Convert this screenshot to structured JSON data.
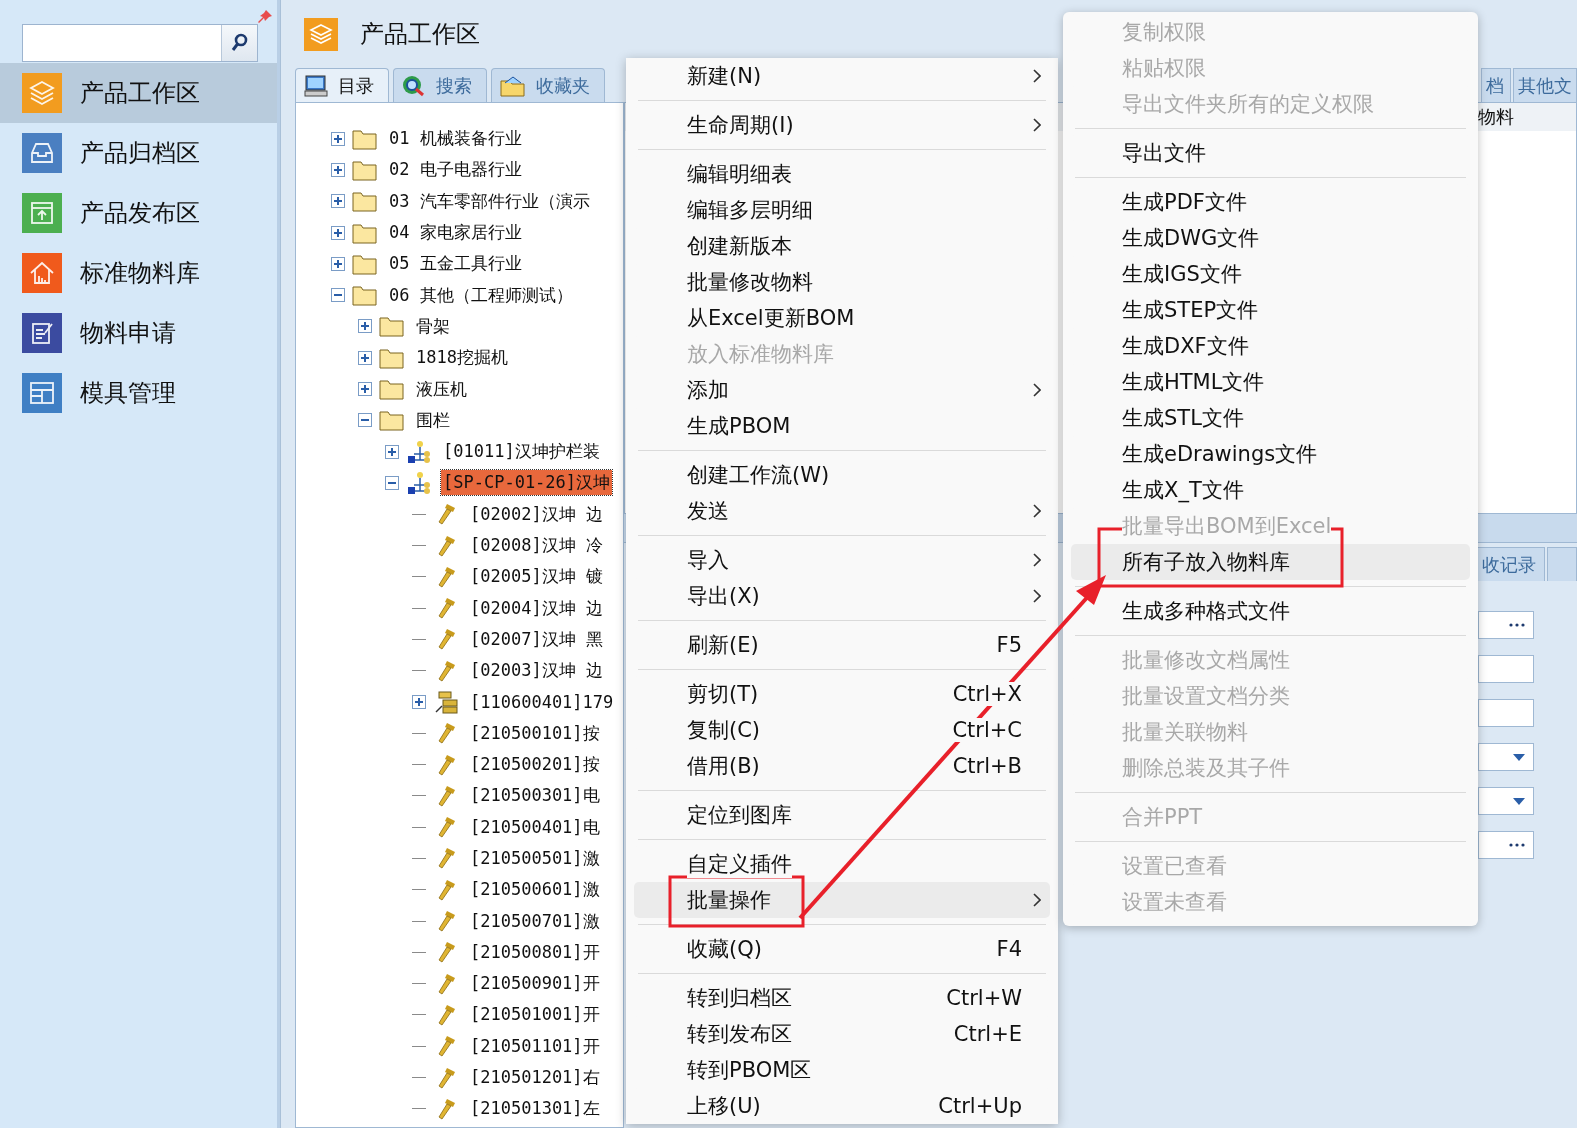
{
  "sidebar": {
    "items": [
      {
        "label": "产品工作区",
        "selected": true
      },
      {
        "label": "产品归档区",
        "selected": false
      },
      {
        "label": "产品发布区",
        "selected": false
      },
      {
        "label": "标准物料库",
        "selected": false
      },
      {
        "label": "物料申请",
        "selected": false
      },
      {
        "label": "模具管理",
        "selected": false
      }
    ]
  },
  "workspace": {
    "title": "产品工作区",
    "tabs": [
      {
        "label": "目录",
        "selected": true
      },
      {
        "label": "搜索",
        "selected": false
      },
      {
        "label": "收藏夹",
        "selected": false
      }
    ],
    "tree": [
      {
        "kind": "folder",
        "label": "01 机械装备行业",
        "expanded": false,
        "selected": false
      },
      {
        "kind": "folder",
        "label": "02 电子电器行业",
        "expanded": false,
        "selected": false
      },
      {
        "kind": "folder",
        "label": "03 汽车零部件行业（演示",
        "expanded": false,
        "selected": false
      },
      {
        "kind": "folder",
        "label": "04 家电家居行业",
        "expanded": false,
        "selected": false
      },
      {
        "kind": "folder",
        "label": "05 五金工具行业",
        "expanded": false,
        "selected": false
      },
      {
        "kind": "folder",
        "label": "06 其他（工程师测试）",
        "expanded": true,
        "selected": false,
        "children": [
          {
            "kind": "folder",
            "label": "骨架",
            "expanded": false,
            "selected": false
          },
          {
            "kind": "folder",
            "label": "1818挖掘机",
            "expanded": false,
            "selected": false
          },
          {
            "kind": "folder",
            "label": "液压机",
            "expanded": false,
            "selected": false
          },
          {
            "kind": "folder",
            "label": "围栏",
            "expanded": true,
            "selected": false,
            "children": [
              {
                "kind": "assembly",
                "label": "[01011]汉坤护栏装",
                "expanded": false,
                "selected": false
              },
              {
                "kind": "assembly",
                "label": "[SP-CP-01-26]汉坤",
                "expanded": true,
                "selected": true,
                "children": [
                  {
                    "kind": "part",
                    "label": "[02002]汉坤 边",
                    "selected": false
                  },
                  {
                    "kind": "part",
                    "label": "[02008]汉坤 冷",
                    "selected": false
                  },
                  {
                    "kind": "part",
                    "label": "[02005]汉坤 镀",
                    "selected": false
                  },
                  {
                    "kind": "part",
                    "label": "[02004]汉坤 边",
                    "selected": false
                  },
                  {
                    "kind": "part",
                    "label": "[02007]汉坤 黑",
                    "selected": false
                  },
                  {
                    "kind": "part",
                    "label": "[02003]汉坤 边",
                    "selected": false
                  },
                  {
                    "kind": "subassembly",
                    "label": "[110600401]179",
                    "expanded": false,
                    "selected": false
                  },
                  {
                    "kind": "part",
                    "label": "[210500101]按",
                    "selected": false
                  },
                  {
                    "kind": "part",
                    "label": "[210500201]按",
                    "selected": false
                  },
                  {
                    "kind": "part",
                    "label": "[210500301]电",
                    "selected": false
                  },
                  {
                    "kind": "part",
                    "label": "[210500401]电",
                    "selected": false
                  },
                  {
                    "kind": "part",
                    "label": "[210500501]激",
                    "selected": false
                  },
                  {
                    "kind": "part",
                    "label": "[210500601]激",
                    "selected": false
                  },
                  {
                    "kind": "part",
                    "label": "[210500701]激",
                    "selected": false
                  },
                  {
                    "kind": "part",
                    "label": "[210500801]开",
                    "selected": false
                  },
                  {
                    "kind": "part",
                    "label": "[210500901]开",
                    "selected": false
                  },
                  {
                    "kind": "part",
                    "label": "[210501001]开",
                    "selected": false
                  },
                  {
                    "kind": "part",
                    "label": "[210501101]开",
                    "selected": false
                  },
                  {
                    "kind": "part",
                    "label": "[210501201]右",
                    "selected": false
                  },
                  {
                    "kind": "part",
                    "label": "[210501301]左",
                    "selected": false
                  }
                ]
              }
            ]
          }
        ]
      }
    ]
  },
  "detail": {
    "tabs": [
      {
        "label": "档",
        "selected": false
      },
      {
        "label": "其他文",
        "selected": false
      }
    ],
    "columns": [
      "物料"
    ],
    "lower_tabs": [
      {
        "label": "收记录",
        "selected": false
      },
      {
        "selected": false
      }
    ],
    "fields": [
      {
        "kind": "browse"
      },
      {
        "kind": "text"
      },
      {
        "kind": "text"
      },
      {
        "kind": "dropdown"
      },
      {
        "kind": "dropdown"
      },
      {
        "kind": "browse"
      }
    ]
  },
  "context_menu": {
    "groups": [
      [
        {
          "label": "新建(N)",
          "submenu": true,
          "disabled": false,
          "selected": false
        }
      ],
      [
        {
          "label": "生命周期(I)",
          "submenu": true,
          "disabled": false,
          "selected": false
        }
      ],
      [
        {
          "label": "编辑明细表",
          "submenu": false,
          "disabled": false,
          "selected": false
        },
        {
          "label": "编辑多层明细",
          "submenu": false,
          "disabled": false,
          "selected": false
        },
        {
          "label": "创建新版本",
          "submenu": false,
          "disabled": false,
          "selected": false
        },
        {
          "label": "批量修改物料",
          "submenu": false,
          "disabled": false,
          "selected": false
        },
        {
          "label": "从Excel更新BOM",
          "submenu": false,
          "disabled": false,
          "selected": false
        },
        {
          "label": "放入标准物料库",
          "submenu": false,
          "disabled": true,
          "selected": false
        },
        {
          "label": "添加",
          "submenu": true,
          "disabled": false,
          "selected": false
        },
        {
          "label": "生成PBOM",
          "submenu": false,
          "disabled": false,
          "selected": false
        }
      ],
      [
        {
          "label": "创建工作流(W)",
          "submenu": false,
          "disabled": false,
          "selected": false
        },
        {
          "label": "发送",
          "submenu": true,
          "disabled": false,
          "selected": false
        }
      ],
      [
        {
          "label": "导入",
          "submenu": true,
          "disabled": false,
          "selected": false
        },
        {
          "label": "导出(X)",
          "submenu": true,
          "disabled": false,
          "selected": false
        }
      ],
      [
        {
          "label": "刷新(E)",
          "shortcut": "F5",
          "submenu": false,
          "disabled": false,
          "selected": false
        }
      ],
      [
        {
          "label": "剪切(T)",
          "shortcut": "Ctrl+X",
          "submenu": false,
          "disabled": false,
          "selected": false
        },
        {
          "label": "复制(C)",
          "shortcut": "Ctrl+C",
          "submenu": false,
          "disabled": false,
          "selected": false
        },
        {
          "label": "借用(B)",
          "shortcut": "Ctrl+B",
          "submenu": false,
          "disabled": false,
          "selected": false
        }
      ],
      [
        {
          "label": "定位到图库",
          "submenu": false,
          "disabled": false,
          "selected": false
        }
      ],
      [
        {
          "label": "自定义插件",
          "submenu": false,
          "disabled": false,
          "selected": false
        },
        {
          "label": "批量操作",
          "submenu": true,
          "disabled": false,
          "selected": true
        }
      ],
      [
        {
          "label": "收藏(Q)",
          "shortcut": "F4",
          "submenu": false,
          "disabled": false,
          "selected": false
        }
      ],
      [
        {
          "label": "转到归档区",
          "shortcut": "Ctrl+W",
          "submenu": false,
          "disabled": false,
          "selected": false
        },
        {
          "label": "转到发布区",
          "shortcut": "Ctrl+E",
          "submenu": false,
          "disabled": false,
          "selected": false
        },
        {
          "label": "转到PBOM区",
          "submenu": false,
          "disabled": false,
          "selected": false
        },
        {
          "label": "上移(U)",
          "shortcut": "Ctrl+Up",
          "submenu": false,
          "disabled": false,
          "selected": false
        }
      ]
    ]
  },
  "submenu": {
    "groups": [
      [
        {
          "label": "复制权限",
          "disabled": true,
          "selected": false
        },
        {
          "label": "粘贴权限",
          "disabled": true,
          "selected": false
        },
        {
          "label": "导出文件夹所有的定义权限",
          "disabled": true,
          "selected": false
        }
      ],
      [
        {
          "label": "导出文件",
          "disabled": false,
          "selected": false
        }
      ],
      [
        {
          "label": "生成PDF文件",
          "disabled": false,
          "selected": false
        },
        {
          "label": "生成DWG文件",
          "disabled": false,
          "selected": false
        },
        {
          "label": "生成IGS文件",
          "disabled": false,
          "selected": false
        },
        {
          "label": "生成STEP文件",
          "disabled": false,
          "selected": false
        },
        {
          "label": "生成DXF文件",
          "disabled": false,
          "selected": false
        },
        {
          "label": "生成HTML文件",
          "disabled": false,
          "selected": false
        },
        {
          "label": "生成STL文件",
          "disabled": false,
          "selected": false
        },
        {
          "label": "生成eDrawings文件",
          "disabled": false,
          "selected": false
        },
        {
          "label": "生成X_T文件",
          "disabled": false,
          "selected": false
        },
        {
          "label": "批量导出BOM到Excel",
          "disabled": true,
          "selected": false
        },
        {
          "label": "所有子放入物料库",
          "disabled": false,
          "selected": true
        }
      ],
      [
        {
          "label": "生成多种格式文件",
          "disabled": false,
          "selected": false
        }
      ],
      [
        {
          "label": "批量修改文档属性",
          "disabled": true,
          "selected": false
        },
        {
          "label": "批量设置文档分类",
          "disabled": true,
          "selected": false
        },
        {
          "label": "批量关联物料",
          "disabled": true,
          "selected": false
        },
        {
          "label": "删除总装及其子件",
          "disabled": true,
          "selected": false
        }
      ],
      [
        {
          "label": "合并PPT",
          "disabled": true,
          "selected": false
        }
      ],
      [
        {
          "label": "设置已查看",
          "disabled": true,
          "selected": false
        },
        {
          "label": "设置未查看",
          "disabled": true,
          "selected": false
        }
      ]
    ]
  }
}
